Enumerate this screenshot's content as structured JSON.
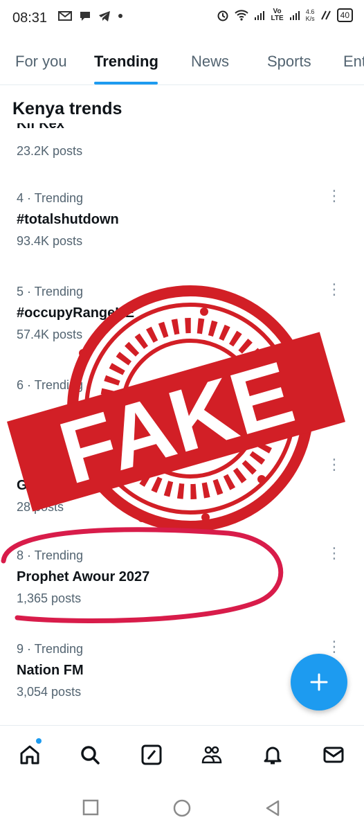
{
  "status_bar": {
    "time": "08:31",
    "lte": "Vo\nLTE",
    "speed_value": "4.6",
    "speed_unit": "K/s",
    "battery": "40"
  },
  "tabs": [
    {
      "label": "For you",
      "active": false
    },
    {
      "label": "Trending",
      "active": true
    },
    {
      "label": "News",
      "active": false
    },
    {
      "label": "Sports",
      "active": false
    },
    {
      "label": "Ent",
      "active": false
    }
  ],
  "section_title": "Kenya trends",
  "clipped_top_trend": {
    "name": "Kif Kex",
    "count": "23.2K posts"
  },
  "trends": [
    {
      "meta": "4 · Trending",
      "name": "#totalshutdown",
      "count": "93.4K posts"
    },
    {
      "meta": "5 · Trending",
      "name": "#occupyRangeKE",
      "count": "57.4K posts"
    },
    {
      "meta": "6 · Trending",
      "name": "",
      "count": ""
    },
    {
      "meta": "",
      "name": "G",
      "count": "28 posts"
    },
    {
      "meta": "8 · Trending",
      "name": "Prophet Awour 2027",
      "count": "1,365 posts"
    },
    {
      "meta": "9 · Trending",
      "name": "Nation FM",
      "count": "3,054 posts"
    }
  ],
  "stamp": {
    "text": "FAKE",
    "color": "#d21f26"
  },
  "annotation_color": "#d81c4a",
  "accent": "#1d9bf0",
  "icons": [
    "home-icon",
    "search-icon",
    "grok-icon",
    "communities-icon",
    "notifications-icon",
    "messages-icon",
    "compose-plus-icon"
  ]
}
